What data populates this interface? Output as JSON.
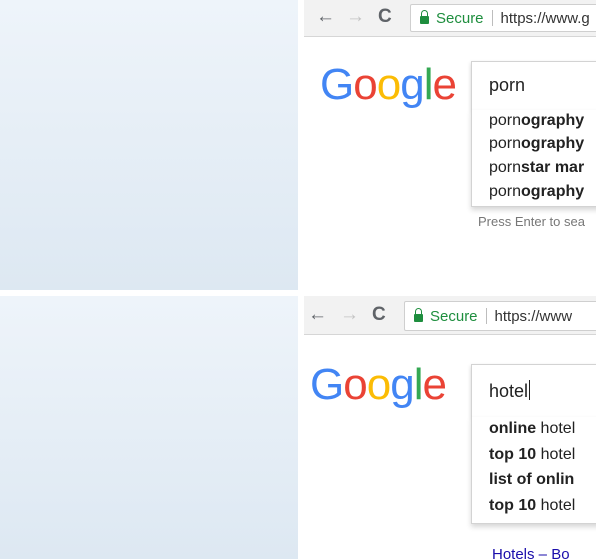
{
  "panels": [
    {
      "id": "top",
      "toolbar": {
        "back": "←",
        "forward": "→",
        "reload": "C",
        "secure_label": "Secure",
        "url": "https://www.g"
      },
      "logo": [
        "G",
        "o",
        "o",
        "g",
        "l",
        "e"
      ],
      "search": {
        "value": "porn"
      },
      "suggestions": [
        {
          "plain": "porn",
          "bold": "ography"
        },
        {
          "plain": "porn",
          "bold": "ography"
        },
        {
          "plain": "porn",
          "bold": "star mar"
        },
        {
          "plain": "porn",
          "bold": "ography"
        }
      ],
      "hint": "Press Enter to sea"
    },
    {
      "id": "bottom",
      "toolbar": {
        "back": "←",
        "forward": "→",
        "reload": "C",
        "secure_label": "Secure",
        "url": "https://www"
      },
      "logo": [
        "G",
        "o",
        "o",
        "g",
        "l",
        "e"
      ],
      "search": {
        "value": "hotel"
      },
      "suggestions": [
        {
          "bold": "online",
          "plain": " hotel"
        },
        {
          "bold": "top 10",
          "plain": " hotel"
        },
        {
          "bold": "list of onlin",
          "plain": ""
        },
        {
          "bold": "top 10",
          "plain": " hotel"
        }
      ],
      "link_fragment": "Hotels – Bo"
    }
  ],
  "colors": {
    "blue": "#4285f4",
    "red": "#ea4335",
    "yellow": "#fbbc05",
    "green": "#34a853",
    "secure": "#1e8e3e"
  }
}
